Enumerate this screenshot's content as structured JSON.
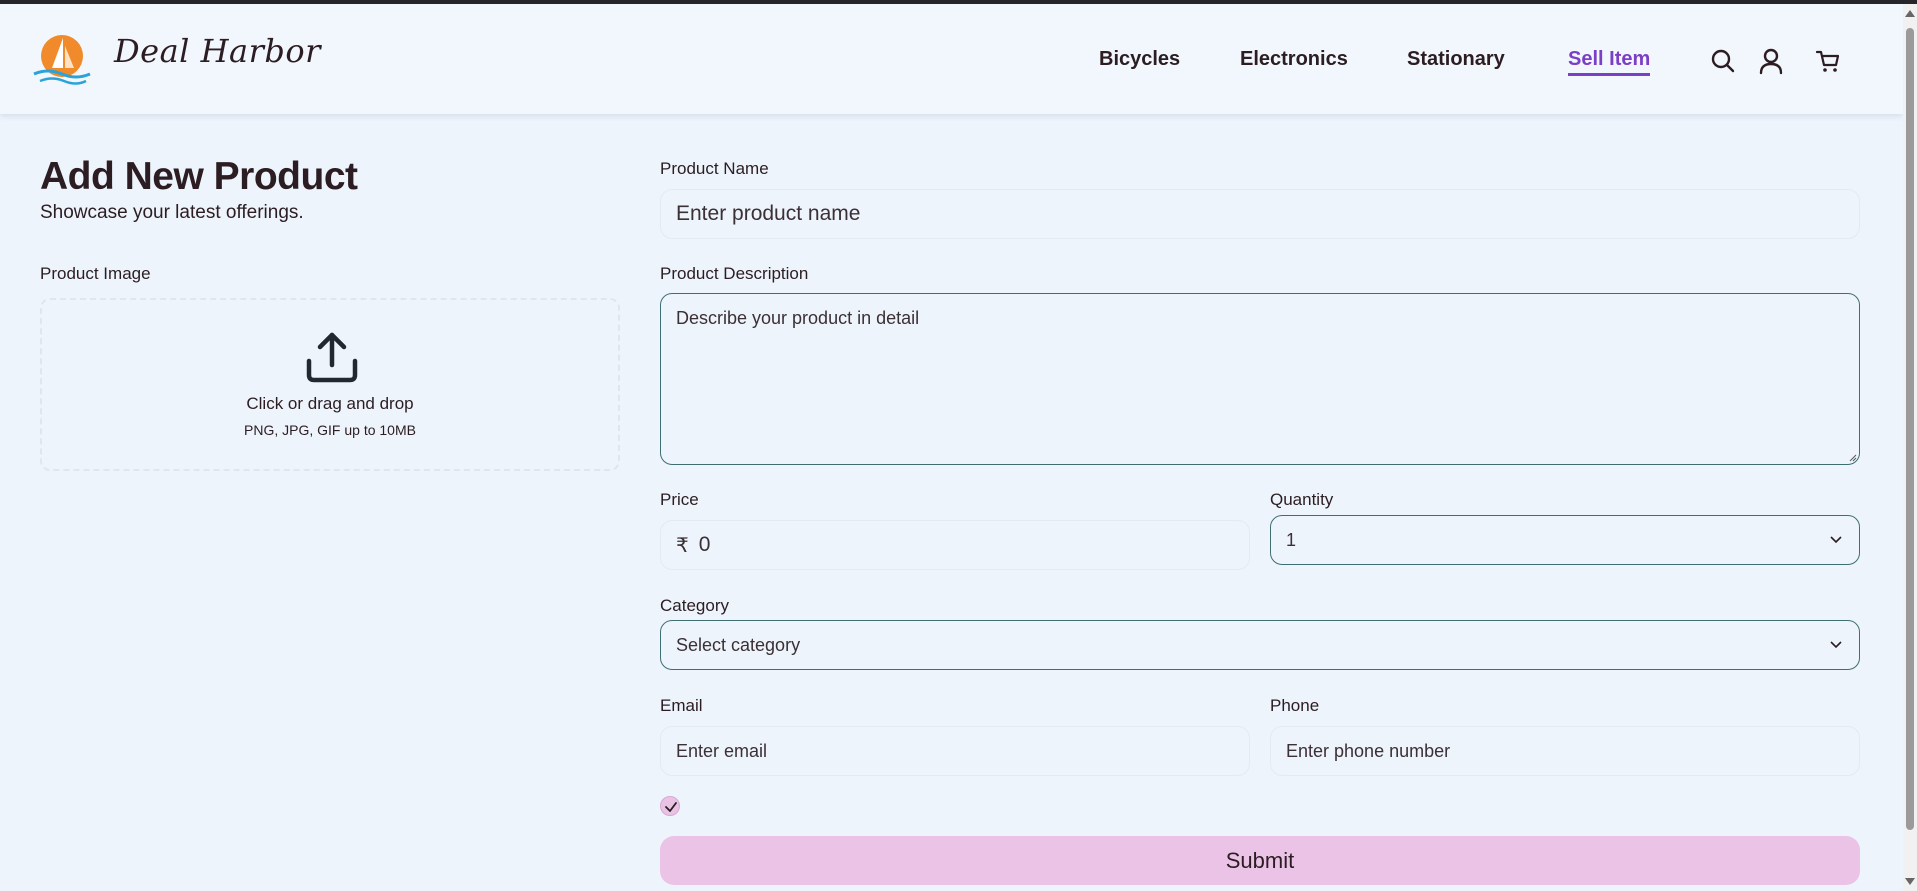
{
  "header": {
    "brand": "Deal Harbor",
    "nav": [
      {
        "label": "Bicycles"
      },
      {
        "label": "Electronics"
      },
      {
        "label": "Stationary"
      },
      {
        "label": "Sell Item",
        "active": true
      }
    ],
    "icons": [
      "search-icon",
      "user-icon",
      "cart-icon"
    ]
  },
  "page": {
    "title": "Add New Product",
    "subtitle": "Showcase your latest offerings."
  },
  "image_upload": {
    "label": "Product Image",
    "main_text": "Click or drag and drop",
    "hint": "PNG, JPG, GIF up to 10MB"
  },
  "form": {
    "name": {
      "label": "Product Name",
      "placeholder": "Enter product name"
    },
    "description": {
      "label": "Product Description",
      "placeholder": "Describe your product in detail"
    },
    "price": {
      "label": "Price",
      "currency": "₹",
      "value": "0"
    },
    "quantity": {
      "label": "Quantity",
      "value": "1"
    },
    "category": {
      "label": "Category",
      "value": "Select category"
    },
    "email": {
      "label": "Email",
      "placeholder": "Enter email"
    },
    "phone": {
      "label": "Phone",
      "placeholder": "Enter phone number"
    },
    "agree_checked": true,
    "submit_label": "Submit"
  },
  "colors": {
    "background": "#eef4fc",
    "accent": "#7b3fc6",
    "submit": "#ebc3e7",
    "input_border": "#3f6f70",
    "logo_sun": "#f08a2a",
    "logo_wave": "#2aa3d8"
  }
}
